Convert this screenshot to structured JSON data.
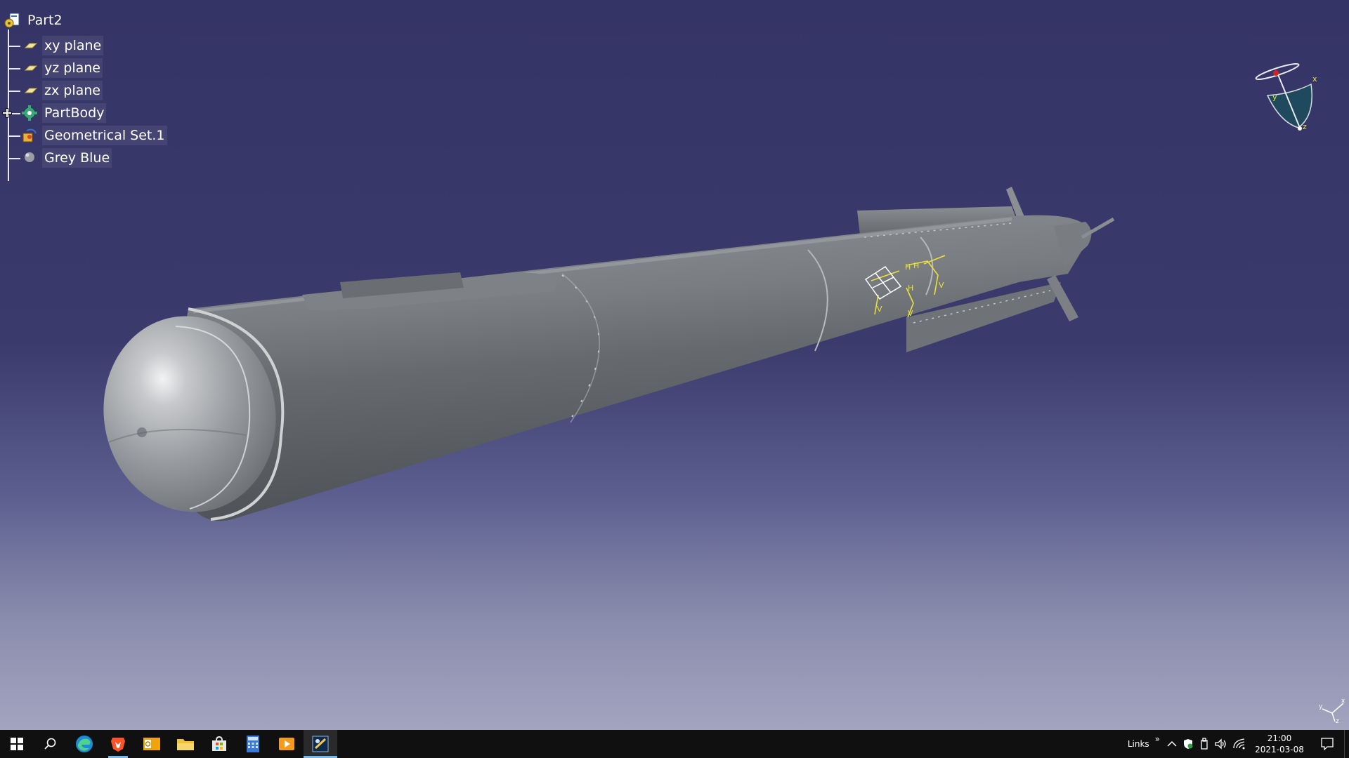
{
  "tree": {
    "root": {
      "label": "Part2",
      "icon": "part-document-icon"
    },
    "items": [
      {
        "label": "xy plane",
        "icon": "plane-icon"
      },
      {
        "label": "yz plane",
        "icon": "plane-icon"
      },
      {
        "label": "zx plane",
        "icon": "plane-icon"
      },
      {
        "label": "PartBody",
        "icon": "part-body-gear-icon",
        "expandable": true
      },
      {
        "label": "Geometrical Set.1",
        "icon": "geometrical-set-icon"
      },
      {
        "label": "Grey Blue",
        "icon": "material-sphere-icon"
      }
    ]
  },
  "compass": {
    "x": "x",
    "y": "y",
    "z": "z"
  },
  "mini_axis": {
    "x": "x",
    "y": "y",
    "z": "z"
  },
  "colors": {
    "background_top": "#353466",
    "background_bottom": "#aaaac3",
    "model_grey": "#76797e",
    "constraint_yellow": "#e8e23a",
    "taskbar": "#101010",
    "taskbar_accent": "#76b9ed"
  },
  "taskbar": {
    "apps": [
      {
        "name": "start-button",
        "icon": "windows-logo-icon"
      },
      {
        "name": "search-button",
        "icon": "search-icon"
      },
      {
        "name": "edge-button",
        "icon": "edge-browser-icon"
      },
      {
        "name": "brave-button",
        "icon": "brave-lion-icon",
        "running": true
      },
      {
        "name": "outlook-button",
        "icon": "outlook-icon"
      },
      {
        "name": "explorer-button",
        "icon": "folder-icon"
      },
      {
        "name": "store-button",
        "icon": "store-bag-icon"
      },
      {
        "name": "calculator-button",
        "icon": "calculator-icon"
      },
      {
        "name": "media-button",
        "icon": "media-player-icon"
      },
      {
        "name": "catia-button",
        "icon": "catia-icon",
        "active": true
      }
    ],
    "links_label": "Links",
    "links_chevron": "»",
    "time": "21:00",
    "date": "2021-03-08"
  }
}
